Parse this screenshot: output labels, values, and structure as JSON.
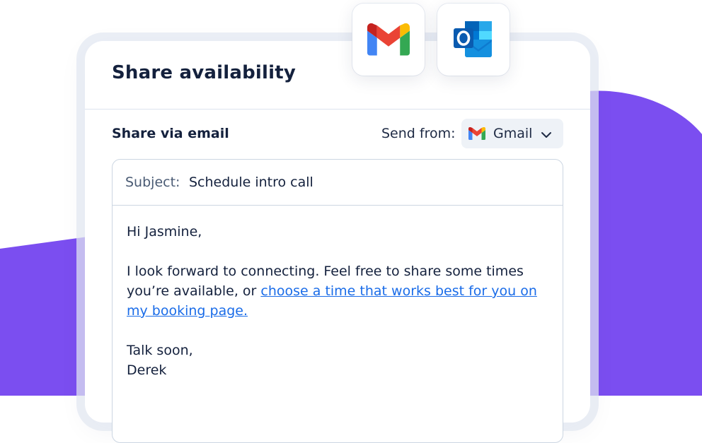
{
  "colors": {
    "accent": "#7b4ef0",
    "link": "#1a6ce8",
    "text_primary": "#14213d"
  },
  "app_tiles": [
    {
      "name": "Gmail",
      "icon": "gmail-icon"
    },
    {
      "name": "Outlook",
      "icon": "outlook-icon"
    }
  ],
  "card": {
    "title": "Share availability"
  },
  "share": {
    "section_label": "Share via email",
    "send_from_label": "Send from:",
    "send_from_value": "Gmail",
    "send_from_icon": "gmail-icon"
  },
  "email": {
    "subject_label": "Subject:",
    "subject_value": "Schedule intro call",
    "greeting": "Hi Jasmine,",
    "message_text": "I look forward to connecting. Feel free to share some times you’re available, or ",
    "link_text": "choose a time that works best for you on my booking page.",
    "signoff": "Talk soon,",
    "signature": "Derek"
  }
}
